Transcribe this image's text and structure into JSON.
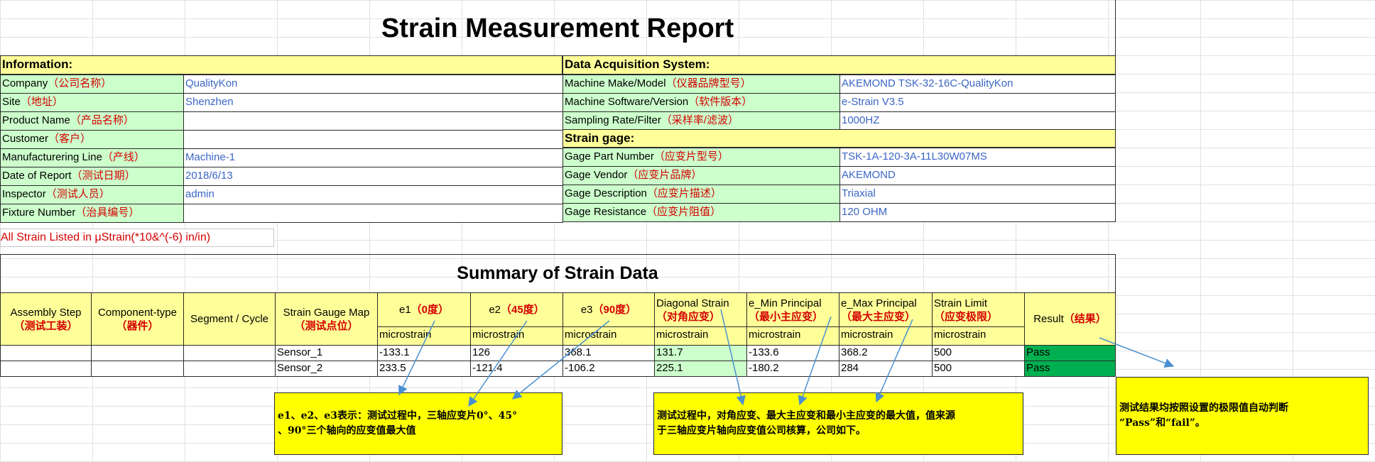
{
  "report_title": "Strain Measurement Report",
  "info": {
    "header": "Information:",
    "rows": [
      {
        "label_en": "Company",
        "label_cn": "（公司名称）",
        "value": "QualityKon"
      },
      {
        "label_en": "Site",
        "label_cn": "（地址）",
        "value": "Shenzhen"
      },
      {
        "label_en": "Product Name",
        "label_cn": "（产品名称）",
        "value": ""
      },
      {
        "label_en": "Customer",
        "label_cn": "（客户）",
        "value": ""
      },
      {
        "label_en": "Manufacturering Line",
        "label_cn": "（产线）",
        "value": "Machine-1"
      },
      {
        "label_en": "Date of Report",
        "label_cn": "（测试日期）",
        "value": "2018/6/13"
      },
      {
        "label_en": "Inspector",
        "label_cn": "（测试人员）",
        "value": "admin"
      },
      {
        "label_en": "Fixture Number",
        "label_cn": "（治具编号）",
        "value": ""
      }
    ]
  },
  "daq": {
    "header": "Data Acquisition System:",
    "rows": [
      {
        "label_en": "Machine Make/Model",
        "label_cn": "（仪器品牌型号）",
        "value": "AKEMOND TSK-32-16C-QualityKon"
      },
      {
        "label_en": "Machine Software/Version",
        "label_cn": "（软件版本）",
        "value": "e-Strain V3.5"
      },
      {
        "label_en": "Sampling Rate/Filter",
        "label_cn": "（采样率/滤波）",
        "value": "1000HZ"
      }
    ]
  },
  "gage": {
    "header": "Strain gage:",
    "rows": [
      {
        "label_en": "Gage Part Number",
        "label_cn": "（应变片型号）",
        "value": "TSK-1A-120-3A-11L30W07MS"
      },
      {
        "label_en": "Gage Vendor",
        "label_cn": "（应变片品牌）",
        "value": "AKEMOND"
      },
      {
        "label_en": "Gage Description",
        "label_cn": "（应变片描述）",
        "value": "Triaxial"
      },
      {
        "label_en": "Gage Resistance",
        "label_cn": "（应变片阻值）",
        "value": "120 OHM"
      }
    ]
  },
  "units_note": "All Strain Listed in μStrain(*10&^(-6) in/in)",
  "summary": {
    "title": "Summary of Strain Data",
    "headers": [
      {
        "en": "Assembly Step",
        "cn": "（测试工装）"
      },
      {
        "en": "Component-type",
        "cn": "（器件）"
      },
      {
        "en": "Segment / Cycle",
        "cn": ""
      },
      {
        "en": "Strain Gauge Map",
        "cn": "（测试点位）"
      },
      {
        "en": "e1",
        "cn": "（0度）"
      },
      {
        "en": "e2",
        "cn": "（45度）"
      },
      {
        "en": "e3",
        "cn": "（90度）"
      },
      {
        "en": "Diagonal Strain",
        "cn": "（对角应变）"
      },
      {
        "en": "e_Min Principal",
        "cn": "（最小主应变）"
      },
      {
        "en": "e_Max Principal",
        "cn": "（最大主应变）"
      },
      {
        "en": "Strain Limit",
        "cn": "（应变极限）"
      },
      {
        "en": "Result",
        "cn": "（结果）"
      }
    ],
    "unit": "microstrain",
    "rows": [
      {
        "assembly": "",
        "component": "",
        "segment": "",
        "sensor": "Sensor_1",
        "e1": "-133.1",
        "e2": "126",
        "e3": "368.1",
        "diagonal": "131.7",
        "emin": "-133.6",
        "emax": "368.2",
        "limit": "500",
        "result": "Pass"
      },
      {
        "assembly": "",
        "component": "",
        "segment": "",
        "sensor": "Sensor_2",
        "e1": "233.5",
        "e2": "-121.4",
        "e3": "-106.2",
        "diagonal": "225.1",
        "emin": "-180.2",
        "emax": "284",
        "limit": "500",
        "result": "Pass"
      }
    ]
  },
  "notes": {
    "axial": "e1、e2、e3表示：测试过程中，三轴应变片0°、45°\n、90°三个轴向的应变值最大值",
    "principal": "测试过程中，对角应变、最大主应变和最小主应变的最大值，值来源\n于三轴应变片轴向应变值公司核算，公司如下。",
    "result": "测试结果均按照设置的极限值自动判断\n“Pass”和“fail”。"
  },
  "colors": {
    "label_bg": "#ccffcc",
    "header_bg": "#ffff99",
    "note_bg": "#ffff00",
    "pass_bg": "#00b050",
    "value_text": "#3b66c4",
    "cn_text": "#d40000",
    "arrow": "#4a90d0"
  }
}
